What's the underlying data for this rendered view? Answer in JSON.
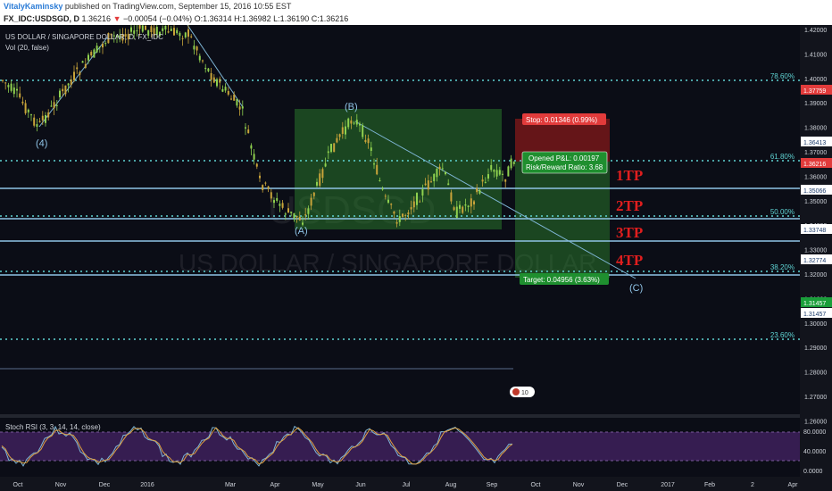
{
  "header": {
    "author": "VitalyKaminsky",
    "published": " published on TradingView.com, September 15, 2016 10:55 EST",
    "symbol": "FX_IDC:USDSGD, D",
    "last": "1.36216",
    "change": "−0.00054 (−0.04%)",
    "ohlc": "O:1.36314 H:1.36982 L:1.36190 C:1.36216"
  },
  "chart": {
    "instrument_title": "US DOLLAR / SINGAPORE DOLLAR, D, FX_IDC",
    "vol_legend": "Vol (20, false)",
    "watermark": "US DOLLAR / SINGAPORE DOLLAR",
    "watermark_logo": "USDSGD",
    "price_ticks": [
      "1.42000",
      "1.41000",
      "1.40000",
      "1.39000",
      "1.38000",
      "1.37000",
      "1.36000",
      "1.35000",
      "1.34000",
      "1.33000",
      "1.32000",
      "1.31000",
      "1.30000",
      "1.29000",
      "1.28000",
      "1.27000",
      "1.26000"
    ],
    "axis_badges": [
      {
        "text": "1.37759",
        "color": "#e23b3b"
      },
      {
        "text": "1.36413",
        "color": "#ffffff"
      },
      {
        "text": "1.36216",
        "color": "#e23b3b"
      },
      {
        "text": "1.35066",
        "color": "#ffffff"
      },
      {
        "text": "1.33748",
        "color": "#ffffff"
      },
      {
        "text": "1.32774",
        "color": "#ffffff"
      },
      {
        "text": "1.31457",
        "color": "#1a9e3a"
      },
      {
        "text": "1.31457",
        "color": "#ffffff"
      }
    ],
    "fib_labels": [
      "78.60%",
      "61.80%",
      "50.00%",
      "38.20%",
      "23.60%"
    ],
    "wave_labels": [
      "(4)",
      "(A)",
      "(B)",
      "(C)"
    ],
    "tp_labels": [
      "1TP",
      "2TP",
      "3TP",
      "4TP"
    ],
    "stop_box": "Stop: 0.01346 (0.99%)",
    "pl_line1": "Opened P&L: 0.00197",
    "pl_line2": "Risk/Reward Ratio: 3.68",
    "target_box": "Target: 0.04956 (3.63%)",
    "time_ticks": [
      "Oct",
      "Nov",
      "Dec",
      "2016",
      "Mar",
      "Apr",
      "May",
      "Jun",
      "Jul",
      "Aug",
      "Sep",
      "Oct",
      "Nov",
      "Dec",
      "2017",
      "Feb",
      "2",
      "Apr"
    ],
    "rsi_legend": "Stoch RSI (3, 3, 14, 14, close)",
    "rsi_ticks": [
      "80.0000",
      "40.0000",
      "0.0000"
    ],
    "flag_label": "10"
  },
  "colors": {
    "background": "#0b0d16",
    "fib_line": "#5fd3d3",
    "tp_line": "#8fc3e6",
    "profit_zone": "#2e8b2e",
    "loss_zone": "#8b1a1a",
    "up_candle": "#8fd14f",
    "down_candle": "#c9a43a",
    "rsi_fill": "#3b1f58",
    "tp_text": "#e01e1e"
  }
}
